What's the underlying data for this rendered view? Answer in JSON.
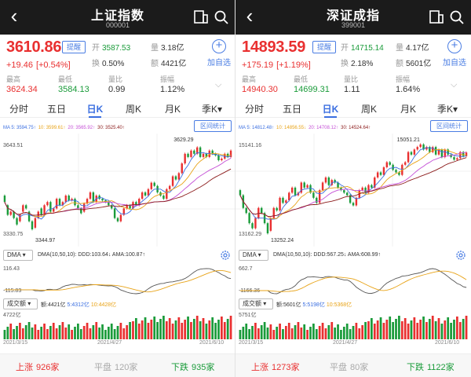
{
  "panels": [
    {
      "title": "上证指数",
      "code": "000001",
      "price": "3610.86",
      "remind": "提醒",
      "change": "+19.46",
      "change_pct": "[+0.54%]",
      "open_label": "开",
      "open": "3587.53",
      "vol_label": "量",
      "vol": "3.18亿",
      "turnover_label": "换",
      "turnover": "0.50%",
      "amount_label": "额",
      "amount": "4421亿",
      "add_watch": "加自选",
      "high_label": "最高",
      "high": "3624.34",
      "low_label": "最低",
      "low": "3584.13",
      "ratio_label": "量比",
      "ratio": "0.99",
      "amp_label": "振幅",
      "amp": "1.12%",
      "ma5": "MA 5: 3594.75↑",
      "ma10": "10: 3599.61↑",
      "ma20": "20: 3565.92↑",
      "ma30": "30: 3525.40↑",
      "interval_stats": "区间统计",
      "y_top": "3643.51",
      "y_bottom": "3330.75",
      "max_label": "3629.29",
      "min_label": "3344.97",
      "dma_select": "DMA",
      "dma_info": "DMA(10,50,10): DDD:103.64↓ AMA:100.87↑",
      "dma_top": "116.43",
      "dma_bottom": "-115.83",
      "vol_select": "成交额",
      "vol_info_a": "额:4421亿",
      "vol_info_b": "5:4312亿",
      "vol_info_c": "10:4428亿",
      "vol_top": "4722亿",
      "date1": "2021/3/15",
      "date2": "2021/4/27",
      "date3": "2021/6/10",
      "rise_label": "上涨",
      "rise": "926家",
      "flat_label": "平盘",
      "flat": "120家",
      "fall_label": "下跌",
      "fall": "935家"
    },
    {
      "title": "深证成指",
      "code": "399001",
      "price": "14893.59",
      "remind": "提醒",
      "change": "+175.19",
      "change_pct": "[+1.19%]",
      "open_label": "开",
      "open": "14715.14",
      "vol_label": "量",
      "vol": "4.17亿",
      "turnover_label": "换",
      "turnover": "2.18%",
      "amount_label": "额",
      "amount": "5601亿",
      "add_watch": "加自选",
      "high_label": "最高",
      "high": "14940.30",
      "low_label": "最低",
      "low": "14699.31",
      "ratio_label": "量比",
      "ratio": "1.11",
      "amp_label": "振幅",
      "amp": "1.64%",
      "ma5": "MA 5: 14812.48↑",
      "ma10": "10: 14856.55↓",
      "ma20": "20: 14708.12↑",
      "ma30": "30: 14524.64↑",
      "interval_stats": "区间统计",
      "y_top": "15141.16",
      "y_bottom": "13162.29",
      "max_label": "15051.21",
      "min_label": "13252.24",
      "dma_select": "DMA",
      "dma_info": "DMA(10,50,10): DDD:567.25↓ AMA:608.99↑",
      "dma_top": "662.7",
      "dma_bottom": "-1166.36",
      "vol_select": "成交额",
      "vol_info_a": "额:5601亿",
      "vol_info_b": "5:5198亿",
      "vol_info_c": "10:5368亿",
      "vol_top": "5751亿",
      "date1": "2021/3/15",
      "date2": "2021/4/27",
      "date3": "2021/6/10",
      "rise_label": "上涨",
      "rise": "1273家",
      "flat_label": "平盘",
      "flat": "80家",
      "fall_label": "下跌",
      "fall": "1122家"
    }
  ],
  "tabs": [
    "分时",
    "五日",
    "日K",
    "周K",
    "月K",
    "季K▾"
  ],
  "active_tab": 2,
  "colors": {
    "up": "#e93030",
    "down": "#1a9b3a",
    "accent": "#3a6ee0",
    "header": "#1b1b1b",
    "ma5": "#3a6ee0",
    "ma10": "#e8a317",
    "ma20": "#c44fd6",
    "ma30": "#8b1a1a"
  },
  "chart_data": [
    {
      "type": "candlestick",
      "name": "上证指数 日K",
      "ylim": [
        3330.75,
        3643.51
      ],
      "close": [
        3450,
        3410,
        3420,
        3400,
        3380,
        3410,
        3440,
        3430,
        3390,
        3365,
        3400,
        3420,
        3410,
        3440,
        3450,
        3420,
        3430,
        3460,
        3440,
        3450,
        3470,
        3455,
        3460,
        3440,
        3430,
        3415,
        3445,
        3460,
        3480,
        3450,
        3470,
        3460,
        3455,
        3450,
        3440,
        3430,
        3400,
        3390,
        3410,
        3430,
        3440,
        3430,
        3450,
        3440,
        3460,
        3480,
        3470,
        3490,
        3510,
        3500,
        3480,
        3470,
        3460,
        3490,
        3500,
        3530,
        3520,
        3540,
        3570,
        3600,
        3590,
        3610,
        3600,
        3620,
        3590,
        3600,
        3590,
        3610,
        3600,
        3595,
        3580,
        3585,
        3600,
        3590,
        3610
      ],
      "open": [
        3470,
        3440,
        3410,
        3420,
        3400,
        3390,
        3420,
        3440,
        3420,
        3390,
        3370,
        3400,
        3430,
        3410,
        3440,
        3450,
        3420,
        3430,
        3460,
        3440,
        3450,
        3470,
        3455,
        3460,
        3440,
        3430,
        3420,
        3445,
        3460,
        3480,
        3450,
        3470,
        3460,
        3455,
        3450,
        3440,
        3430,
        3400,
        3390,
        3410,
        3430,
        3440,
        3430,
        3450,
        3440,
        3460,
        3480,
        3470,
        3490,
        3510,
        3500,
        3480,
        3470,
        3460,
        3490,
        3500,
        3530,
        3520,
        3540,
        3570,
        3600,
        3590,
        3610,
        3600,
        3620,
        3590,
        3600,
        3590,
        3610,
        3600,
        3595,
        3580,
        3585,
        3600,
        3590
      ],
      "max": 3629.29,
      "min": 3344.97
    },
    {
      "type": "candlestick",
      "name": "深证成指 日K",
      "ylim": [
        13162.29,
        15141.16
      ],
      "close": [
        14050,
        13800,
        13700,
        13500,
        13400,
        13600,
        13800,
        13700,
        13500,
        13300,
        13600,
        13800,
        13750,
        14000,
        13900,
        13950,
        14100,
        14200,
        14050,
        14100,
        14300,
        14200,
        14250,
        14100,
        14000,
        13900,
        14150,
        14300,
        14400,
        14250,
        14350,
        14300,
        14200,
        14150,
        14100,
        14050,
        13900,
        13850,
        14000,
        14150,
        14200,
        14100,
        14250,
        14200,
        14400,
        14500,
        14450,
        14600,
        14700,
        14650,
        14550,
        14500,
        14450,
        14650,
        14700,
        14900,
        14850,
        14950,
        15000,
        15050,
        14950,
        15000,
        14900,
        15000,
        14850,
        14950,
        14800,
        14950,
        14850,
        14800,
        14750,
        14780,
        14900,
        14820,
        14890
      ],
      "open": [
        14150,
        14050,
        13800,
        13700,
        13500,
        13400,
        13600,
        13800,
        13700,
        13500,
        13350,
        13600,
        13800,
        13750,
        14000,
        13900,
        13950,
        14100,
        14200,
        14050,
        14100,
        14300,
        14200,
        14250,
        14100,
        14000,
        13900,
        14150,
        14300,
        14400,
        14250,
        14350,
        14300,
        14200,
        14150,
        14100,
        14050,
        13900,
        13850,
        14000,
        14150,
        14200,
        14100,
        14250,
        14200,
        14400,
        14500,
        14450,
        14600,
        14700,
        14650,
        14550,
        14500,
        14450,
        14650,
        14700,
        14900,
        14850,
        14950,
        15000,
        15050,
        14950,
        15000,
        14900,
        15000,
        14850,
        14950,
        14800,
        14950,
        14850,
        14800,
        14750,
        14780,
        14900,
        14820
      ],
      "max": 15051.21,
      "min": 13252.24
    }
  ]
}
